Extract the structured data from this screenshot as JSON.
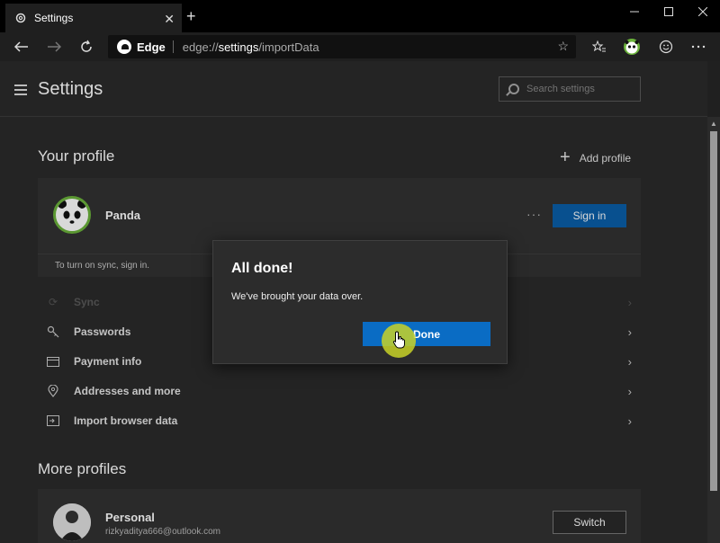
{
  "browser": {
    "tab_title": "Settings",
    "tab_close": "✕",
    "new_tab": "+",
    "brand": "Edge",
    "url_prefix": "edge://",
    "url_bold": "settings",
    "url_suffix": "/importData"
  },
  "header": {
    "title": "Settings",
    "search_placeholder": "Search settings"
  },
  "profile": {
    "section_title": "Your profile",
    "add_profile_label": "Add profile",
    "name": "Panda",
    "more_dots": "···",
    "signin_label": "Sign in",
    "sync_hint": "To turn on sync, sign in."
  },
  "settings_rows": [
    {
      "label": "Sync",
      "icon": "sync-icon"
    },
    {
      "label": "Passwords",
      "icon": "key-icon"
    },
    {
      "label": "Payment info",
      "icon": "card-icon"
    },
    {
      "label": "Addresses and more",
      "icon": "location-icon"
    },
    {
      "label": "Import browser data",
      "icon": "import-icon"
    }
  ],
  "more_profiles": {
    "section_title": "More profiles",
    "name": "Personal",
    "email": "rizkyaditya666@outlook.com",
    "switch_label": "Switch"
  },
  "dialog": {
    "title": "All done!",
    "message": "We've brought your data over.",
    "done_label": "Done"
  },
  "colors": {
    "accent": "#0a6cc4",
    "panda_ring": "#6bb33b",
    "cursor_highlight": "#c8d228"
  }
}
